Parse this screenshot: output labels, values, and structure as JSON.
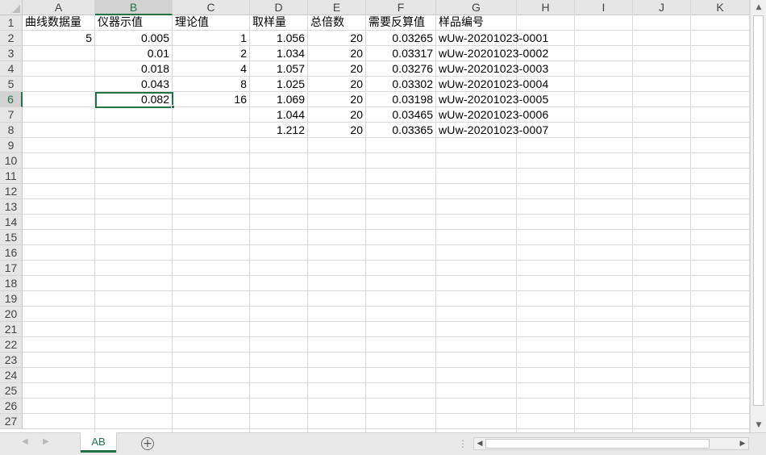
{
  "columns": [
    {
      "letter": "A",
      "active": false
    },
    {
      "letter": "B",
      "active": true
    },
    {
      "letter": "C",
      "active": false
    },
    {
      "letter": "D",
      "active": false
    },
    {
      "letter": "E",
      "active": false
    },
    {
      "letter": "F",
      "active": false
    },
    {
      "letter": "G",
      "active": false
    },
    {
      "letter": "H",
      "active": false
    },
    {
      "letter": "I",
      "active": false
    },
    {
      "letter": "J",
      "active": false
    },
    {
      "letter": "K",
      "active": false
    }
  ],
  "row_count": 27,
  "active_row": 6,
  "active_cell": "B6",
  "cells": [
    {
      "ref": "A1",
      "value": "曲线数据量",
      "type": "txt"
    },
    {
      "ref": "B1",
      "value": "仪器示值",
      "type": "txt"
    },
    {
      "ref": "C1",
      "value": "理论值",
      "type": "txt"
    },
    {
      "ref": "D1",
      "value": "取样量",
      "type": "txt"
    },
    {
      "ref": "E1",
      "value": "总倍数",
      "type": "txt"
    },
    {
      "ref": "F1",
      "value": "需要反算值",
      "type": "txt"
    },
    {
      "ref": "G1",
      "value": "样品编号",
      "type": "txt"
    },
    {
      "ref": "A2",
      "value": "5",
      "type": "num"
    },
    {
      "ref": "B2",
      "value": "0.005",
      "type": "num"
    },
    {
      "ref": "C2",
      "value": "1",
      "type": "num"
    },
    {
      "ref": "D2",
      "value": "1.056",
      "type": "num"
    },
    {
      "ref": "E2",
      "value": "20",
      "type": "num"
    },
    {
      "ref": "F2",
      "value": "0.03265",
      "type": "num"
    },
    {
      "ref": "G2",
      "value": "wUw-20201023-0001",
      "type": "code"
    },
    {
      "ref": "B3",
      "value": "0.01",
      "type": "num"
    },
    {
      "ref": "C3",
      "value": "2",
      "type": "num"
    },
    {
      "ref": "D3",
      "value": "1.034",
      "type": "num"
    },
    {
      "ref": "E3",
      "value": "20",
      "type": "num"
    },
    {
      "ref": "F3",
      "value": "0.03317",
      "type": "num"
    },
    {
      "ref": "G3",
      "value": "wUw-20201023-0002",
      "type": "code"
    },
    {
      "ref": "B4",
      "value": "0.018",
      "type": "num"
    },
    {
      "ref": "C4",
      "value": "4",
      "type": "num"
    },
    {
      "ref": "D4",
      "value": "1.057",
      "type": "num"
    },
    {
      "ref": "E4",
      "value": "20",
      "type": "num"
    },
    {
      "ref": "F4",
      "value": "0.03276",
      "type": "num"
    },
    {
      "ref": "G4",
      "value": "wUw-20201023-0003",
      "type": "code"
    },
    {
      "ref": "B5",
      "value": "0.043",
      "type": "num"
    },
    {
      "ref": "C5",
      "value": "8",
      "type": "num"
    },
    {
      "ref": "D5",
      "value": "1.025",
      "type": "num"
    },
    {
      "ref": "E5",
      "value": "20",
      "type": "num"
    },
    {
      "ref": "F5",
      "value": "0.03302",
      "type": "num"
    },
    {
      "ref": "G5",
      "value": "wUw-20201023-0004",
      "type": "code"
    },
    {
      "ref": "B6",
      "value": "0.082",
      "type": "num"
    },
    {
      "ref": "C6",
      "value": "16",
      "type": "num"
    },
    {
      "ref": "D6",
      "value": "1.069",
      "type": "num"
    },
    {
      "ref": "E6",
      "value": "20",
      "type": "num"
    },
    {
      "ref": "F6",
      "value": "0.03198",
      "type": "num"
    },
    {
      "ref": "G6",
      "value": "wUw-20201023-0005",
      "type": "code"
    },
    {
      "ref": "D7",
      "value": "1.044",
      "type": "num"
    },
    {
      "ref": "E7",
      "value": "20",
      "type": "num"
    },
    {
      "ref": "F7",
      "value": "0.03465",
      "type": "num"
    },
    {
      "ref": "G7",
      "value": "wUw-20201023-0006",
      "type": "code"
    },
    {
      "ref": "D8",
      "value": "1.212",
      "type": "num"
    },
    {
      "ref": "E8",
      "value": "20",
      "type": "num"
    },
    {
      "ref": "F8",
      "value": "0.03365",
      "type": "num"
    },
    {
      "ref": "G8",
      "value": "wUw-20201023-0007",
      "type": "code"
    }
  ],
  "sheet_tabs": [
    {
      "label": "AB",
      "active": true
    }
  ],
  "icons": {
    "tab_prev": "chevron-left-icon",
    "tab_next": "chevron-right-icon",
    "add_sheet": "plus-circle-icon",
    "scroll_up": "triangle-up-icon",
    "scroll_down": "triangle-down-icon",
    "scroll_left": "triangle-left-icon",
    "scroll_right": "triangle-right-icon"
  },
  "colors": {
    "accent": "#217346",
    "header_bg": "#e6e6e6",
    "gridline": "#dadada"
  }
}
